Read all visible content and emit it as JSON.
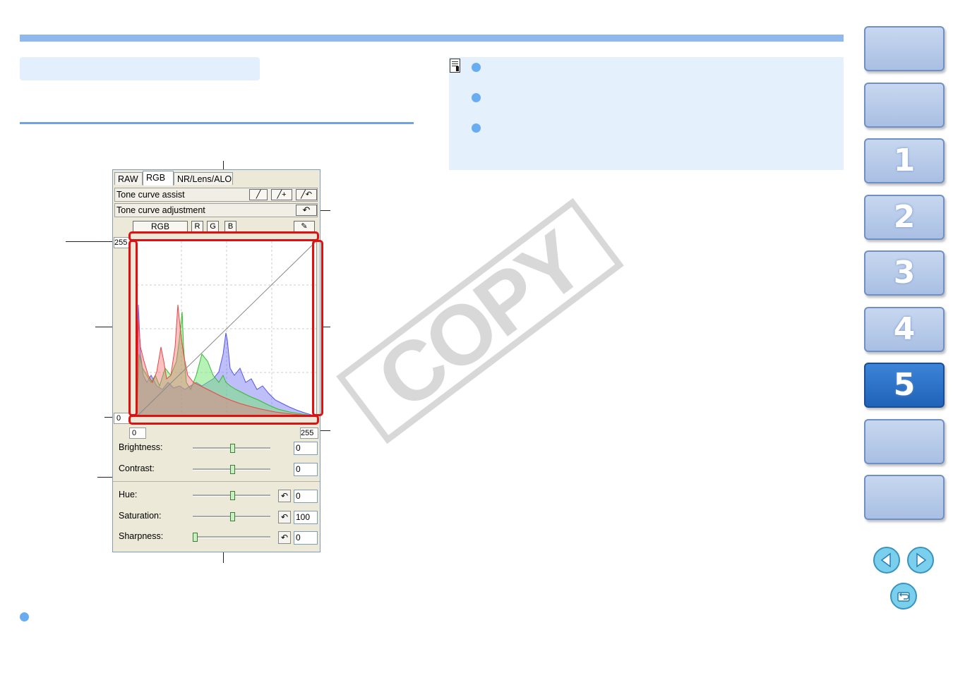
{
  "watermark": "COPY",
  "panel": {
    "tabs": [
      "RAW",
      "RGB",
      "NR/Lens/ALO"
    ],
    "tone_curve_assist": "Tone curve assist",
    "tone_curve_adjustment": "Tone curve adjustment",
    "channels": [
      "RGB",
      "R",
      "G",
      "B"
    ],
    "axis": {
      "y_max": "255",
      "y_min": "0",
      "x_min": "0",
      "x_max": "255"
    },
    "sliders": [
      {
        "label": "Brightness:",
        "value": "0"
      },
      {
        "label": "Contrast:",
        "value": "0"
      },
      {
        "label": "Hue:",
        "value": "0"
      },
      {
        "label": "Saturation:",
        "value": "100"
      },
      {
        "label": "Sharpness:",
        "value": "0"
      }
    ]
  },
  "side_nav": [
    "",
    "",
    "1",
    "2",
    "3",
    "4",
    "5",
    "",
    ""
  ],
  "active_chapter": "5",
  "icons": [
    "note-icon",
    "prev-page-icon",
    "next-page-icon",
    "return-icon",
    "reset-icon",
    "eyedropper-icon"
  ]
}
